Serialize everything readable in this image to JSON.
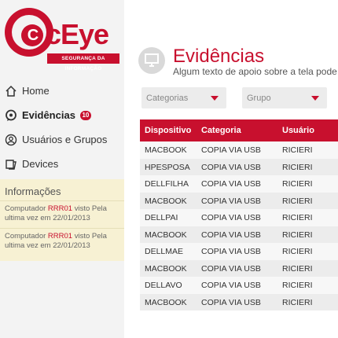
{
  "brand": {
    "name": "cEye",
    "tagline": "SEGURANÇA DA INFORMAÇÃO"
  },
  "nav": {
    "items": [
      {
        "label": "Home",
        "icon": "house-icon"
      },
      {
        "label": "Evidências",
        "icon": "chat-icon",
        "badge": "10",
        "active": true
      },
      {
        "label": "Usuários e Grupos",
        "icon": "user-icon"
      },
      {
        "label": "Devices",
        "icon": "device-icon"
      }
    ]
  },
  "info": {
    "title": "Informações",
    "entries": [
      {
        "prefix": "Computador ",
        "device": "RRR01",
        "suffix": " visto  Pela ultima vez em 22/01/2013"
      },
      {
        "prefix": "Computador ",
        "device": "RRR01",
        "suffix": " visto  Pela ultima vez em 22/01/2013"
      }
    ]
  },
  "main": {
    "title": "Evidências",
    "subtitle": "Algum texto de apoio sobre a tela pode",
    "filters": {
      "category_placeholder": "Categorias",
      "group_placeholder": "Grupo"
    }
  },
  "table": {
    "headers": [
      "Dispositivo",
      "Categoria",
      "Usuário"
    ],
    "rows": [
      [
        "MACBOOK",
        "COPIA VIA USB",
        "RICIERI"
      ],
      [
        "HPESPOSA",
        "COPIA VIA USB",
        "RICIERI"
      ],
      [
        "DELLFILHA",
        "COPIA VIA USB",
        "RICIERI"
      ],
      [
        "MACBOOK",
        "COPIA VIA USB",
        "RICIERI"
      ],
      [
        "DELLPAI",
        "COPIA VIA USB",
        "RICIERI"
      ],
      [
        "MACBOOK",
        "COPIA VIA USB",
        "RICIERI"
      ],
      [
        "DELLMAE",
        "COPIA VIA USB",
        "RICIERI"
      ],
      [
        "MACBOOK",
        "COPIA VIA USB",
        "RICIERI"
      ],
      [
        "DELLAVO",
        "COPIA VIA USB",
        "RICIERI"
      ],
      [
        "MACBOOK",
        "COPIA VIA USB",
        "RICIERI"
      ]
    ]
  },
  "colors": {
    "accent": "#c8102e",
    "info_bg": "#f7f1d3",
    "sidebar_bg": "#f3f3f3"
  }
}
